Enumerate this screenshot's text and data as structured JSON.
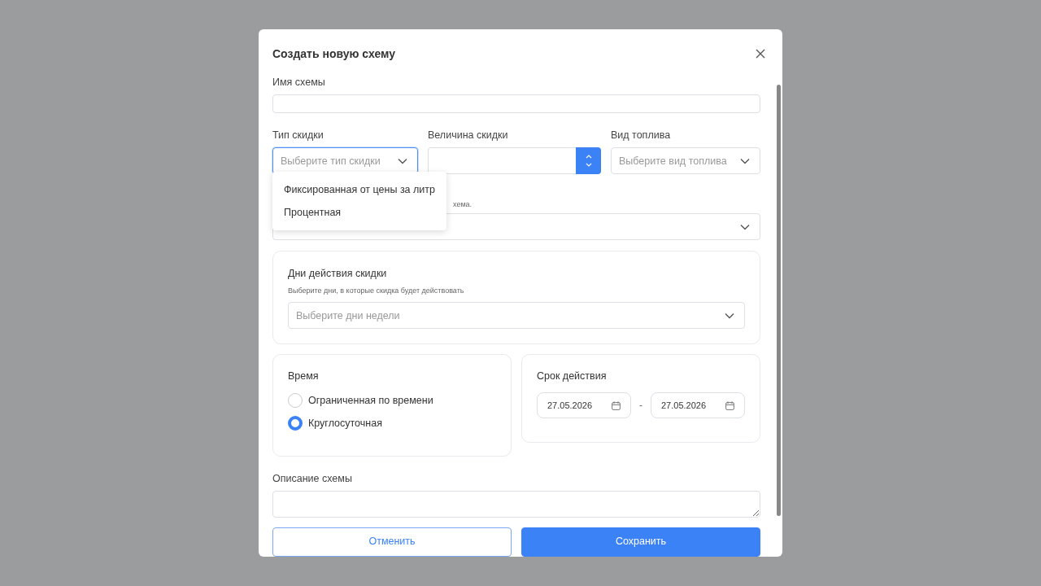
{
  "dialog": {
    "title": "Создать новую схему",
    "name_field": {
      "label": "Имя схемы"
    },
    "discount_type": {
      "label": "Тип скидки",
      "placeholder": "Выберите тип скидки",
      "expanded": true,
      "options": [
        "Фиксированная от цены за литр",
        "Процентная"
      ]
    },
    "discount_value": {
      "label": "Величина скидки"
    },
    "fuel_type": {
      "label": "Вид топлива",
      "placeholder": "Выберите вид топлива"
    },
    "covered_field": {
      "hint": "хема."
    },
    "days": {
      "title": "Дни действия скидки",
      "hint": "Выберите дни, в которые скидка будет действовать",
      "placeholder": "Выберите дни недели"
    },
    "time": {
      "title": "Время",
      "options": [
        {
          "label": "Ограниченная по времени",
          "selected": false
        },
        {
          "label": "Круглосуточная",
          "selected": true
        }
      ]
    },
    "validity": {
      "title": "Срок действия",
      "from": "27.05.2026",
      "separator": "-",
      "to": "27.05.2026"
    },
    "description": {
      "label": "Описание схемы"
    },
    "buttons": [
      {
        "label": "Отменить",
        "kind": "secondary"
      },
      {
        "label": "Сохранить",
        "kind": "primary"
      }
    ]
  }
}
